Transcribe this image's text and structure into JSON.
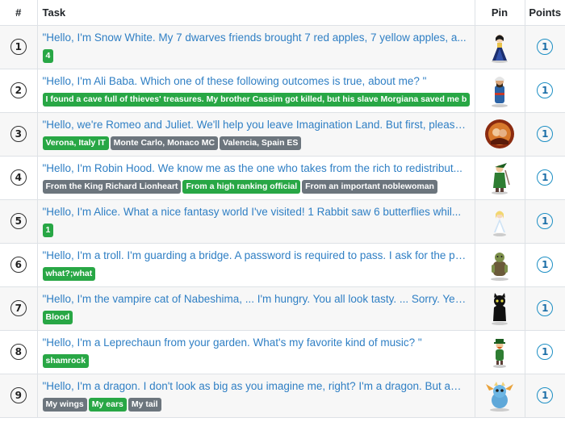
{
  "table": {
    "headers": {
      "num": "#",
      "task": "Task",
      "pin": "Pin",
      "points": "Points"
    },
    "rows": [
      {
        "num": "1",
        "title": "\"Hello, I'm Snow White. My 7 dwarves friends brought 7 red apples, 7 yellow apples, a...",
        "answers": [
          {
            "text": "4",
            "style": "green"
          }
        ],
        "pin": "snow-white",
        "points": "1"
      },
      {
        "num": "2",
        "title": "\"Hello, I'm Ali Baba. Which one of these following outcomes is true, about me? \"",
        "answers": [
          {
            "text": "I found a cave full of thieves' treasures. My brother Cassim got killed, but his slave Morgiana saved me b",
            "style": "green"
          }
        ],
        "pin": "ali-baba",
        "points": "1"
      },
      {
        "num": "3",
        "title": "\"Hello, we're Romeo and Juliet. We'll help you leave Imagination Land. But first, please ...",
        "answers": [
          {
            "text": "Verona, Italy IT",
            "style": "green"
          },
          {
            "text": "Monte Carlo, Monaco MC",
            "style": "gray"
          },
          {
            "text": "Valencia, Spain ES",
            "style": "gray"
          }
        ],
        "pin": "romeo-juliet",
        "points": "1"
      },
      {
        "num": "4",
        "title": "\"Hello, I'm Robin Hood. We know me as the one who takes from the rich to redistribut...",
        "answers": [
          {
            "text": "From the King Richard Lionheart",
            "style": "gray"
          },
          {
            "text": "From a high ranking official",
            "style": "green"
          },
          {
            "text": "From an important noblewoman",
            "style": "gray"
          }
        ],
        "pin": "robin-hood",
        "points": "1"
      },
      {
        "num": "5",
        "title": "\"Hello, I'm Alice. What a nice fantasy world I've visited! 1 Rabbit saw 6 butterflies whil...",
        "answers": [
          {
            "text": "1",
            "style": "green"
          }
        ],
        "pin": "alice",
        "points": "1"
      },
      {
        "num": "6",
        "title": "\"Hello, I'm a troll. I'm guarding a bridge. A password is required to pass. I ask for the pa...",
        "answers": [
          {
            "text": "what?;what",
            "style": "green"
          }
        ],
        "pin": "troll",
        "points": "1"
      },
      {
        "num": "7",
        "title": "\"Hello, I'm the vampire cat of Nabeshima, ... I'm hungry. You all look tasty. ... Sorry. Yes, ...",
        "answers": [
          {
            "text": "Blood",
            "style": "green"
          }
        ],
        "pin": "vampire-cat",
        "points": "1"
      },
      {
        "num": "8",
        "title": "\"Hello, I'm a Leprechaun from your garden. What's my favorite kind of music? \"",
        "answers": [
          {
            "text": "shamrock",
            "style": "green"
          }
        ],
        "pin": "leprechaun",
        "points": "1"
      },
      {
        "num": "9",
        "title": "\"Hello, I'm a dragon. I don't look as big as you imagine me, right? I'm a dragon. But am I...",
        "answers": [
          {
            "text": "My wings",
            "style": "gray"
          },
          {
            "text": "My ears",
            "style": "green"
          },
          {
            "text": "My tail",
            "style": "gray"
          }
        ],
        "pin": "dragon",
        "points": "1"
      }
    ]
  }
}
